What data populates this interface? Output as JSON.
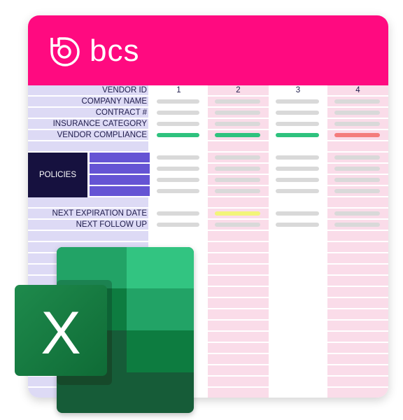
{
  "brand": {
    "name": "bcs",
    "color": "#FF0A80"
  },
  "table": {
    "vendor_ids": [
      "1",
      "2",
      "3",
      "4"
    ],
    "rows": [
      {
        "label": "VENDOR ID",
        "type": "ids"
      },
      {
        "label": "COMPANY NAME",
        "bars": [
          "gray",
          "gray",
          "gray",
          "gray"
        ]
      },
      {
        "label": "CONTRACT #",
        "bars": [
          "gray",
          "gray",
          "gray",
          "gray"
        ]
      },
      {
        "label": "INSURANCE CATEGORY",
        "bars": [
          "gray",
          "gray",
          "gray",
          "gray"
        ]
      },
      {
        "label": "VENDOR COMPLIANCE",
        "bars": [
          "green",
          "green",
          "green",
          "red"
        ]
      },
      {
        "label": "",
        "bars": []
      },
      {
        "label": "",
        "bars": [
          "gray",
          "gray",
          "gray",
          "gray"
        ],
        "policy": true
      },
      {
        "label": "",
        "bars": [
          "gray",
          "gray",
          "gray",
          "gray"
        ],
        "policy": true
      },
      {
        "label": "",
        "bars": [
          "gray",
          "gray",
          "gray",
          "gray"
        ],
        "policy": true
      },
      {
        "label": "",
        "bars": [
          "gray",
          "gray",
          "gray",
          "gray"
        ],
        "policy": true
      },
      {
        "label": "",
        "bars": []
      },
      {
        "label": "NEXT EXPIRATION DATE",
        "bars": [
          "gray",
          "yellow",
          "gray",
          "gray"
        ]
      },
      {
        "label": "NEXT FOLLOW UP",
        "bars": [
          "gray",
          "gray",
          "gray",
          "gray"
        ]
      }
    ],
    "policies_label": "POLICIES",
    "colors": {
      "gray": "#D9D9D9",
      "green": "#2EC27E",
      "red": "#F47C7C",
      "yellow": "#F2F57A"
    }
  },
  "excel_logo": {
    "letter": "X"
  }
}
